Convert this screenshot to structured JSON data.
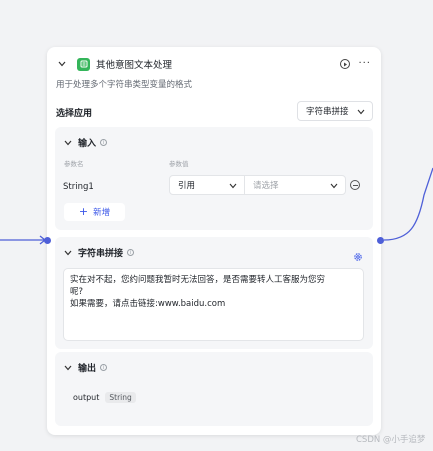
{
  "node": {
    "title": "其他意图文本处理",
    "description": "用于处理多个字符串类型变量的格式",
    "app_label": "选择应用",
    "app_value": "字符串拼接",
    "colors": {
      "accent": "#3a56e8",
      "node_icon": "#34b55a",
      "connector": "#4e5fd8"
    }
  },
  "input": {
    "title": "输入",
    "col_name": "参数名",
    "col_value": "参数值",
    "param_name": "String1",
    "ref_value": "引用",
    "pick_placeholder": "请选择",
    "add_label": "新增"
  },
  "concat": {
    "title": "字符串拼接",
    "line1": "实在对不起，您约问题我暂时无法回答，是否需要转人工客服为您穷",
    "line2": "呢?",
    "line3": "如果需要，请点击链接:www.baidu.com"
  },
  "output": {
    "title": "输出",
    "name": "output",
    "type": "String"
  },
  "watermark": "CSDN @小手追梦"
}
